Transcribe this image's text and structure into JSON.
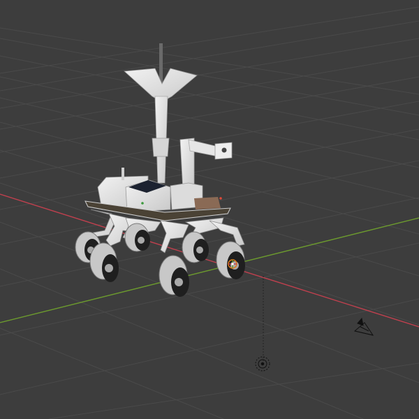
{
  "app": "3D viewport",
  "viewport": {
    "background": "#3d3d3d",
    "grid_color": "#4a4a4a",
    "x_axis_color": "#c0404e",
    "y_axis_color": "#6c9a2e"
  },
  "scene": {
    "objects": [
      {
        "name": "rover-model",
        "type": "mesh"
      },
      {
        "name": "camera",
        "type": "camera"
      },
      {
        "name": "light",
        "type": "light"
      }
    ],
    "origin_marker_icon": "origin-gizmo-icon"
  }
}
